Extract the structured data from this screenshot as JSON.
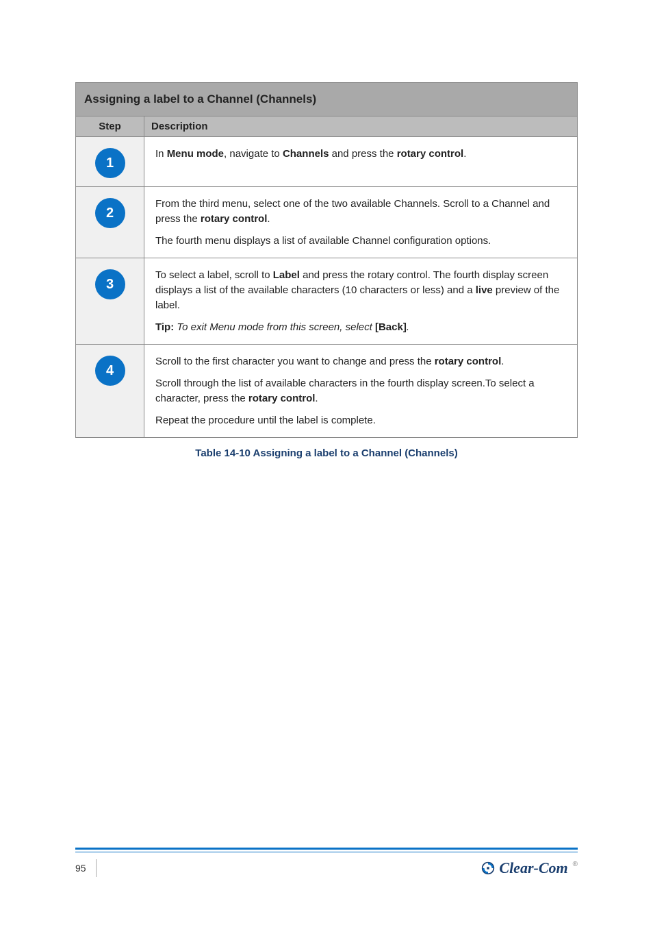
{
  "table": {
    "title": "Assigning a label to a Channel (Channels)",
    "headers": {
      "step": "Step",
      "desc": "Description"
    },
    "rows": [
      {
        "num": "1",
        "paras": [
          "In <b>Menu mode</b>, navigate to <b>Channels</b> and press the <b>rotary control</b>."
        ]
      },
      {
        "num": "2",
        "paras": [
          "From the third menu, select one of the two available Channels. Scroll to a Channel and press the <b>rotary control</b>.",
          "The fourth menu displays a list of available Channel configuration options."
        ]
      },
      {
        "num": "3",
        "paras": [
          "To select a label, scroll to <b>Label</b> and press the rotary control. The fourth display screen displays a list of the available characters (10 characters or less) and a <b>live</b> preview of the label.",
          "<span class='note-label'>Tip:</span> <i>To exit Menu mode from this screen, select</i> <b>[Back]</b><i>.</i>"
        ]
      },
      {
        "num": "4",
        "paras": [
          "Scroll to the first character you want to change and press the <b>rotary control</b>.",
          "Scroll through the list of available characters in the fourth display screen.To select a character, press the <b>rotary control</b>.",
          "Repeat the procedure until the label is complete."
        ]
      }
    ]
  },
  "caption": "Table 14-10 Assigning a label to a Channel (Channels)",
  "footer": {
    "page": "95",
    "brand": "Clear-Com"
  }
}
